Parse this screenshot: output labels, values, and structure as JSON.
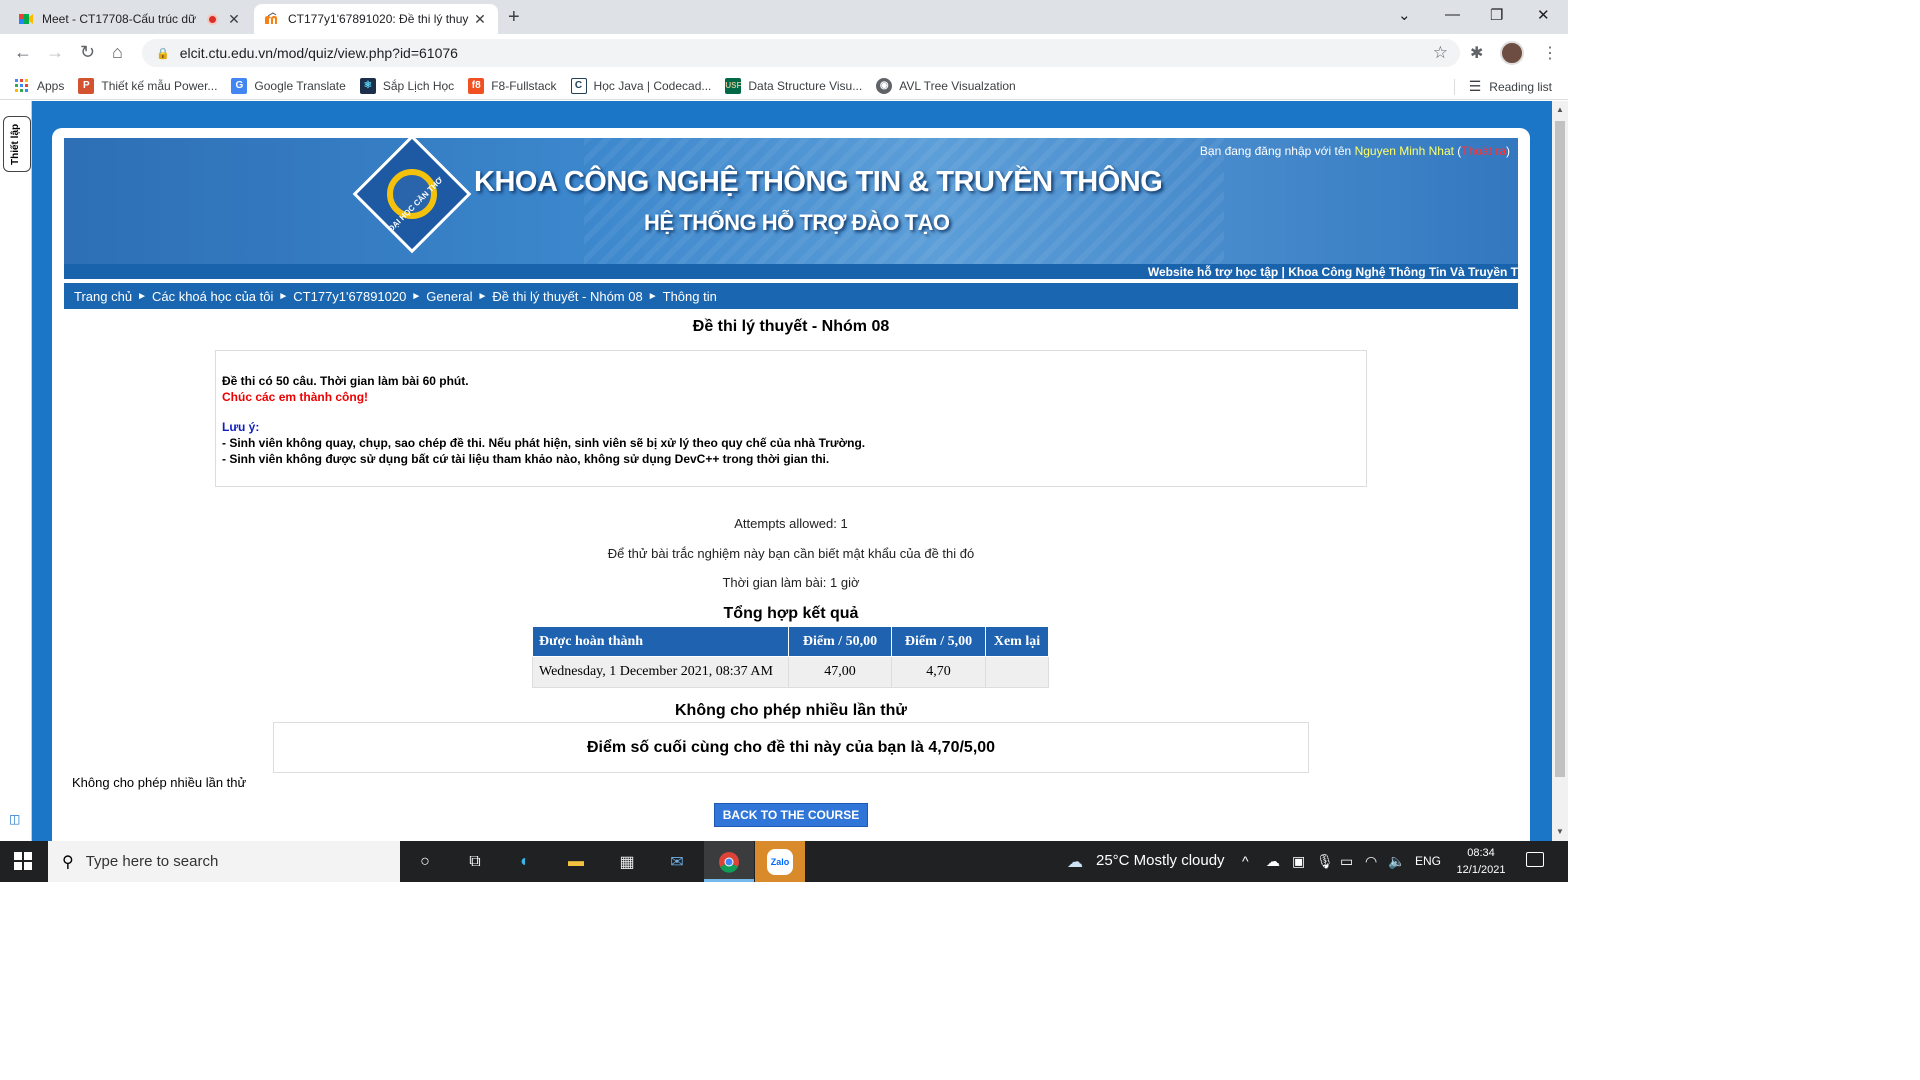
{
  "browser": {
    "tabs": [
      {
        "title": "Meet - CT17708-Cấu trúc dữ",
        "close": "✕"
      },
      {
        "title": "CT177y1'67891020: Đề thi lý thuy",
        "close": "✕"
      }
    ],
    "new_tab": "+",
    "window_controls": {
      "minimize": "—",
      "maximize": "❐",
      "close": "✕",
      "tab_search": "⌄"
    },
    "url": "elcit.ctu.edu.vn/mod/quiz/view.php?id=61076",
    "bookmarks": [
      {
        "label": "Apps",
        "icon": "apps-grid-icon",
        "color": "#4285f4"
      },
      {
        "label": "Thiết kế mẫu Power...",
        "icon": "powerpoint-icon",
        "color": "#d35230"
      },
      {
        "label": "Google Translate",
        "icon": "google-translate-icon",
        "color": "#4285f4"
      },
      {
        "label": "Sắp Lịch Học",
        "icon": "react-icon",
        "color": "#1b2f4a"
      },
      {
        "label": "F8-Fullstack",
        "icon": "f8-icon",
        "color": "#f05123"
      },
      {
        "label": "Học Java | Codecad...",
        "icon": "codecademy-icon",
        "color": "#1f4056"
      },
      {
        "label": "Data Structure Visu...",
        "icon": "usf-icon",
        "color": "#006747"
      },
      {
        "label": "AVL Tree Visualzation",
        "icon": "globe-icon",
        "color": "#5f6368"
      }
    ],
    "reading_list": "Reading list"
  },
  "sidebar": {
    "vertical_tab": "Thiết lập"
  },
  "header": {
    "brand_line1": "KHOA CÔNG NGHỆ THÔNG TIN & TRUYỀN THÔNG",
    "brand_line2": "HỆ THỐNG HỖ TRỢ ĐÀO TẠO",
    "logo_text": "ĐẠI HỌC CẦN THƠ",
    "login_prefix": "Bạn đang đăng nhập với tên ",
    "login_user": "Nguyen Minh Nhat",
    "login_logout": "Thoát ra",
    "marquee": "Website hỗ trợ học tập | Khoa Công Nghệ Thông Tin Và Truyền T"
  },
  "breadcrumb": [
    "Trang chủ",
    "Các khoá học của tôi",
    "CT177y1'67891020",
    "General",
    "Đề thi lý thuyết - Nhóm 08",
    "Thông tin"
  ],
  "breadcrumb_separator": "►",
  "quiz": {
    "title": "Đề thi lý thuyết - Nhóm 08",
    "intro_line1": "Đề thi có 50 câu. Thời gian làm bài 60 phút.",
    "intro_line2": "Chúc các em thành công!",
    "note_heading": "Lưu ý:",
    "note_line1": "- Sinh viên không quay, chụp, sao chép đề thi. Nếu phát hiện, sinh viên sẽ bị xử lý theo quy chế của nhà Trường.",
    "note_line2": "- Sinh viên không được sử dụng bất cứ tài liệu tham khảo nào, không sử dụng DevC++ trong thời gian thi.",
    "attempts_allowed": "Attempts allowed: 1",
    "password_note": "Để thử bài trắc nghiệm này bạn cần biết mật khẩu của đề thi đó",
    "time_limit": "Thời gian làm bài: 1 giờ",
    "summary_title": "Tổng hợp kết quả",
    "table": {
      "headers": [
        "Được hoàn thành",
        "Điểm / 50,00",
        "Điểm / 5,00",
        "Xem lại"
      ],
      "rows": [
        [
          "Wednesday, 1 December 2021, 08:37 AM",
          "47,00",
          "4,70",
          ""
        ]
      ]
    },
    "no_more_attempts": "Không cho phép nhiều lần thử",
    "final_grade": "Điểm số cuối cùng cho đề thi này của bạn là 4,70/5,00",
    "no_more_attempts_left": "Không cho phép nhiều lần thử",
    "back_button": "BACK TO THE COURSE"
  },
  "taskbar": {
    "search_placeholder": "Type here to search",
    "weather": "25°C  Mostly cloudy",
    "language": "ENG",
    "time": "08:34",
    "date": "12/1/2021",
    "zalo": "Zalo"
  },
  "colors": {
    "page_blue": "#1c76c8",
    "table_header": "#1f63b0",
    "accent_red": "#e00000",
    "note_blue": "#1020c0"
  }
}
